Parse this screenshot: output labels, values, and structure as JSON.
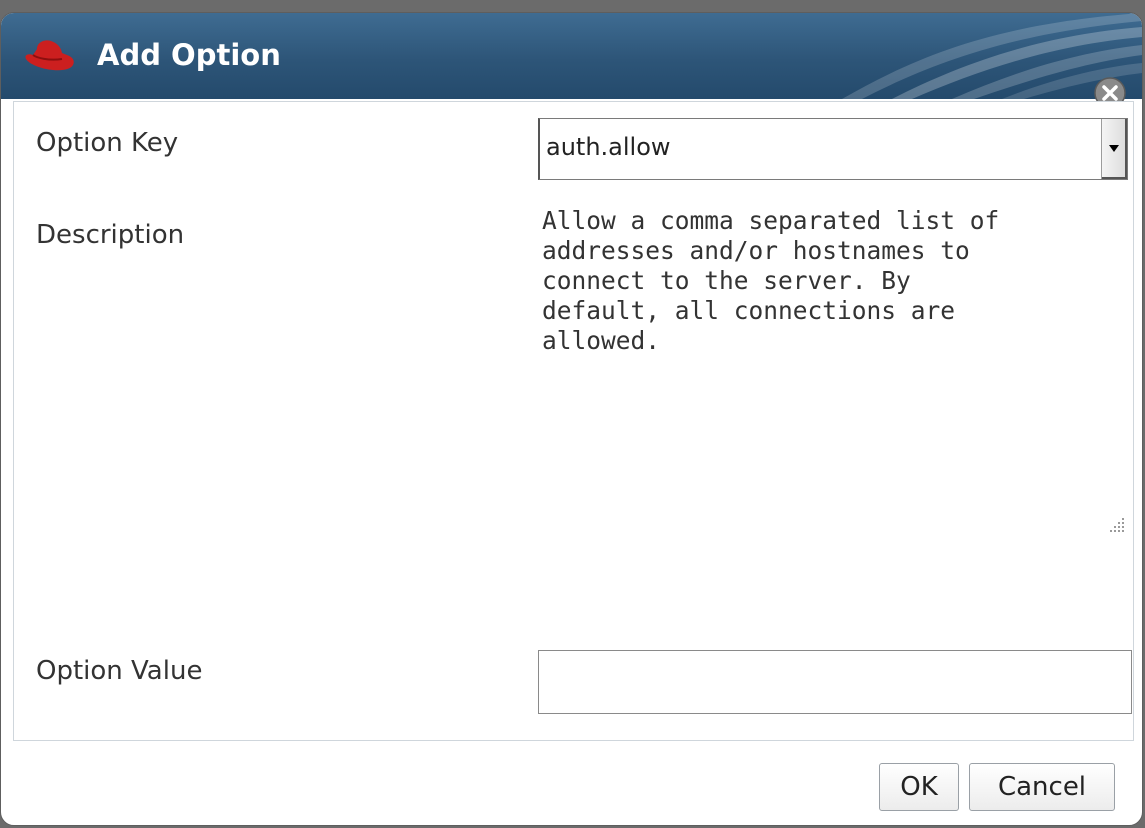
{
  "dialog": {
    "title": "Add Option",
    "title_icon": "red-hat-icon",
    "close_icon": "close-icon"
  },
  "form": {
    "option_key_label": "Option Key",
    "option_key_value": "auth.allow",
    "description_label": "Description",
    "description_text": "Allow a comma separated list of\naddresses and/or hostnames to\nconnect to the server. By\ndefault, all connections are\nallowed.",
    "option_value_label": "Option Value",
    "option_value_value": ""
  },
  "buttons": {
    "ok_label": "OK",
    "cancel_label": "Cancel"
  },
  "colors": {
    "titlebar": "#2d5578",
    "icon_red": "#cc1f1f"
  }
}
